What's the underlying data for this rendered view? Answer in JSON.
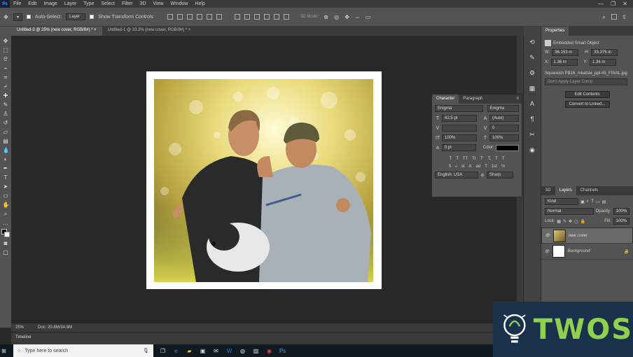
{
  "menubar": {
    "app_icon": "Ps",
    "items": [
      "File",
      "Edit",
      "Image",
      "Layer",
      "Type",
      "Select",
      "Filter",
      "3D",
      "View",
      "Window",
      "Help"
    ],
    "window_controls": [
      "—",
      "❐",
      "✕"
    ]
  },
  "options": {
    "auto_select_label": "Auto-Select:",
    "auto_select_value": "Layer",
    "show_transform_label": "Show Transform Controls",
    "mode_3d_label": "3D Mode:"
  },
  "tabs": [
    {
      "label": "Untitled-3 @ 25% (new cover, RGB/8#) *",
      "active": true
    },
    {
      "label": "Untitled-1 @ 33.3% (new cover, RGB/8#) *",
      "active": false
    }
  ],
  "status": {
    "zoom": "25%",
    "doc": "Doc: 20.8M/34.8M"
  },
  "timeline": {
    "label": "Timeline"
  },
  "properties": {
    "tab": "Properties",
    "object_type": "Embedded Smart Object",
    "w_label": "W:",
    "w_value": "36.153 in",
    "h_label": "H:",
    "h_value": "33.375 in",
    "x_label": "X:",
    "x_value": "1.36 in",
    "y_label": "Y:",
    "y_value": "1.36 in",
    "filename": "Squareish PB16_meatsie_ppl-45_FINAL.jpg",
    "layer_comp": "Don't Apply Layer Comp",
    "edit_btn": "Edit Contents",
    "convert_btn": "Convert to Linked..."
  },
  "character": {
    "tab_char": "Character",
    "tab_para": "Paragraph",
    "font_family": "Enigma",
    "font_style": "Enigma",
    "size": "62.5 pt",
    "leading": "(Auto)",
    "tracking": "0",
    "vscale": "100%",
    "hscale": "100%",
    "baseline": "0 pt",
    "color_label": "Color:",
    "language": "English: USA",
    "antialias": "Sharp",
    "style_buttons": [
      "T",
      "T",
      "TT",
      "Tr",
      "T'",
      "T,",
      "T",
      "T"
    ],
    "ot_buttons": [
      "fi",
      "ℴ",
      "st",
      "A",
      "ad",
      "T",
      "1st",
      "½"
    ]
  },
  "layers": {
    "tabs": [
      "3D",
      "Layers",
      "Channels"
    ],
    "active_tab": "Layers",
    "kind": "Kind",
    "blend": "Normal",
    "opacity_label": "Opacity:",
    "opacity": "100%",
    "lock_label": "Lock:",
    "fill_label": "Fill:",
    "fill": "100%",
    "items": [
      {
        "name": "new cover",
        "selected": true
      },
      {
        "name": "Background",
        "selected": false
      }
    ]
  },
  "taskbar": {
    "search_placeholder": "Type here to search"
  },
  "watermark": {
    "text": "TWOS"
  },
  "colors": {
    "accent": "#31a8ff",
    "panel": "#535353",
    "dark": "#3a3a3a",
    "brand_green": "#8fd14f",
    "brand_navy": "#19314b"
  }
}
